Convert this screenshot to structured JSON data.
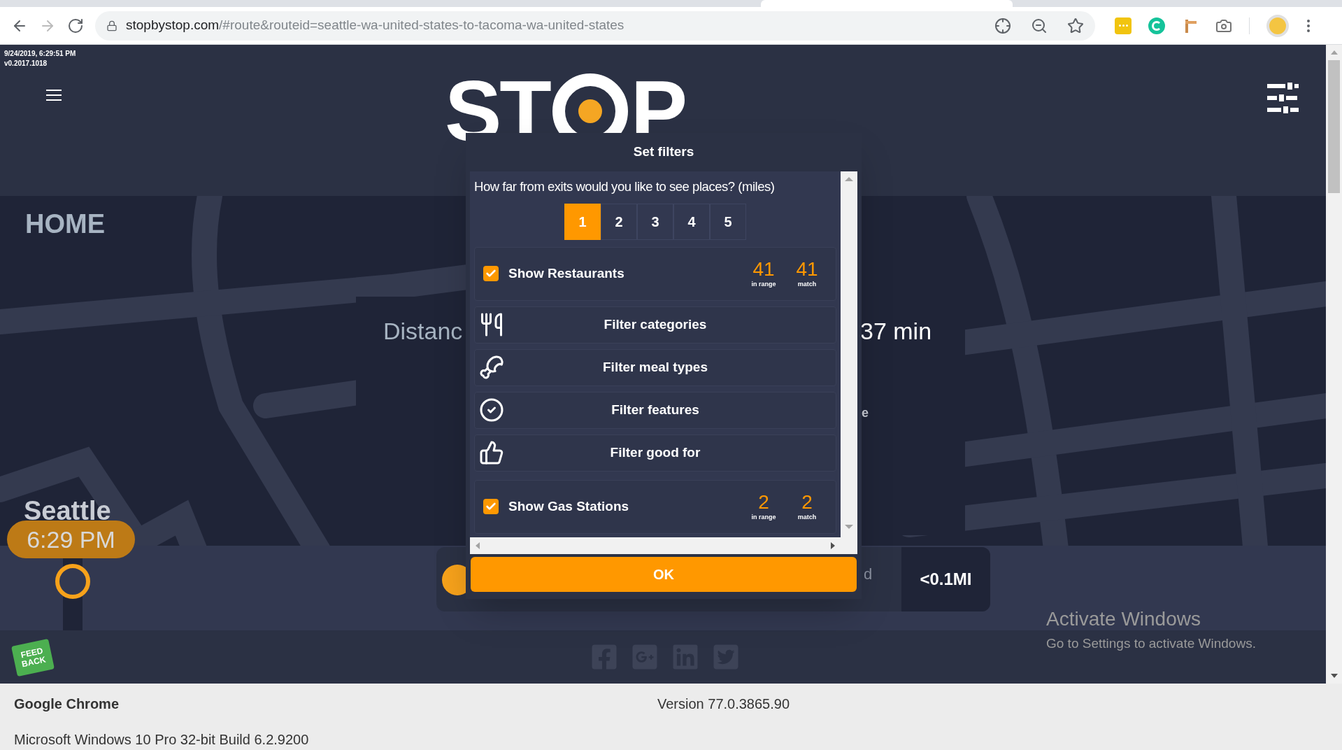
{
  "browser": {
    "url_host": "stopbystop.com",
    "url_path": "/#route&routeid=seattle-wa-united-states-to-tacoma-wa-united-states"
  },
  "header": {
    "timestamp": "9/24/2019, 6:29:51 PM",
    "version": "v0.2017.1018",
    "logo_before": "ST",
    "logo_after": "P"
  },
  "route": {
    "origin_label": "HOME",
    "distance_label": "Distanc",
    "duration": "37 min",
    "fragment_1": "e",
    "fragment_2": "d",
    "city": "Seattle",
    "time": "6:29 PM",
    "next_distance": "<0.1MI"
  },
  "feedback": "FEED BACK",
  "modal": {
    "title": "Set filters",
    "question": "How far from exits would you like to see places? (miles)",
    "distances": [
      {
        "label": "1",
        "selected": true
      },
      {
        "label": "2",
        "selected": false
      },
      {
        "label": "3",
        "selected": false
      },
      {
        "label": "4",
        "selected": false
      },
      {
        "label": "5",
        "selected": false
      }
    ],
    "sections": [
      {
        "kind": "toggle",
        "label": "Show Restaurants",
        "checked": true,
        "in_range": "41",
        "in_range_label": "in range",
        "match": "41",
        "match_label": "match"
      },
      {
        "kind": "filter",
        "label": "Filter categories"
      },
      {
        "kind": "filter",
        "label": "Filter meal types"
      },
      {
        "kind": "filter",
        "label": "Filter features"
      },
      {
        "kind": "filter",
        "label": "Filter good for"
      },
      {
        "kind": "toggle",
        "label": "Show Gas Stations",
        "checked": true,
        "in_range": "2",
        "in_range_label": "in range",
        "match": "2",
        "match_label": "match"
      }
    ],
    "ok": "OK"
  },
  "watermark": {
    "title": "Activate Windows",
    "subtitle": "Go to Settings to activate Windows."
  },
  "system_info": {
    "browser": "Google Chrome",
    "version": "Version 77.0.3865.90",
    "os": "Microsoft Windows 10 Pro 32-bit Build 6.2.9200"
  }
}
